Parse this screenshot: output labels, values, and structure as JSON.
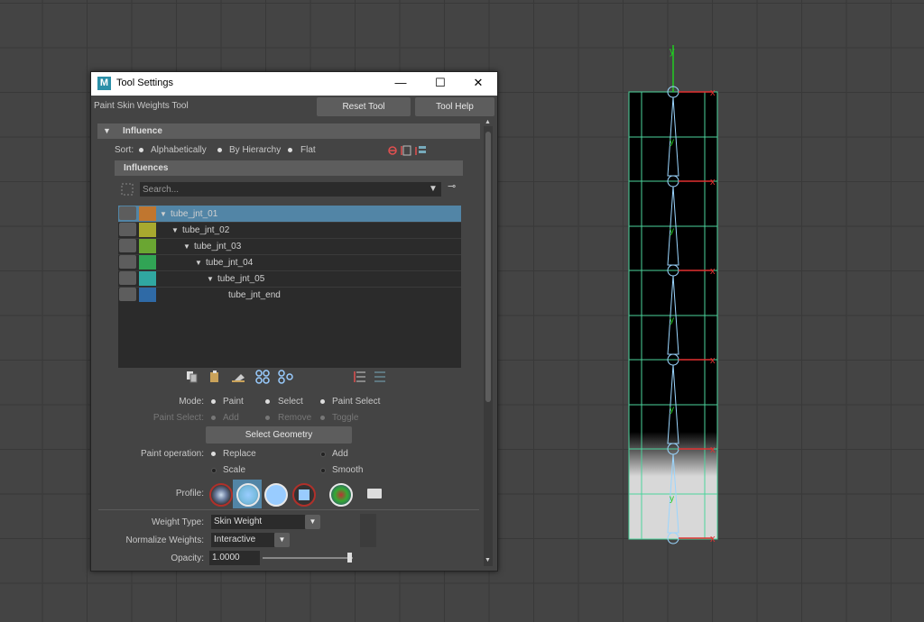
{
  "window": {
    "title": "Tool Settings",
    "logo": "M",
    "minimize_icon": "—",
    "maximize_icon": "☐",
    "close_icon": "✕"
  },
  "tool": {
    "name": "Paint Skin Weights Tool",
    "reset_label": "Reset Tool",
    "help_label": "Tool Help"
  },
  "influence": {
    "header": "Influence",
    "sort_label": "Sort:",
    "sort_options": [
      "Alphabetically",
      "By Hierarchy",
      "Flat"
    ],
    "sort_selected": "By Hierarchy",
    "subheader": "Influences",
    "search_placeholder": "Search...",
    "joints": [
      {
        "name": "tube_jnt_01",
        "color": "#c0762f",
        "depth": 0,
        "selected": true,
        "expanded": true
      },
      {
        "name": "tube_jnt_02",
        "color": "#a8a92f",
        "depth": 1,
        "selected": false,
        "expanded": true
      },
      {
        "name": "tube_jnt_03",
        "color": "#6aa632",
        "depth": 2,
        "selected": false,
        "expanded": true
      },
      {
        "name": "tube_jnt_04",
        "color": "#31a455",
        "depth": 3,
        "selected": false,
        "expanded": true
      },
      {
        "name": "tube_jnt_05",
        "color": "#30a7a1",
        "depth": 4,
        "selected": false,
        "expanded": true
      },
      {
        "name": "tube_jnt_end",
        "color": "#2f6aa6",
        "depth": 5,
        "selected": false,
        "expanded": false
      }
    ]
  },
  "mode": {
    "label": "Mode:",
    "options": [
      "Paint",
      "Select",
      "Paint Select"
    ],
    "selected": "Paint"
  },
  "paint_select": {
    "label": "Paint Select:",
    "options": [
      "Add",
      "Remove",
      "Toggle"
    ]
  },
  "select_geometry_label": "Select Geometry",
  "paint_operation": {
    "label": "Paint operation:",
    "options": [
      "Replace",
      "Add",
      "Scale",
      "Smooth"
    ],
    "selected": "Replace"
  },
  "profile": {
    "label": "Profile:",
    "selected_index": 1
  },
  "weight_type": {
    "label": "Weight Type:",
    "value": "Skin Weight"
  },
  "normalize": {
    "label": "Normalize Weights:",
    "value": "Interactive"
  },
  "opacity": {
    "label": "Opacity:",
    "value": "1.0000",
    "fraction": 1.0
  },
  "viewport": {
    "axis_y": "y",
    "axis_x": "x",
    "colors": {
      "joint": "#9bd6ff",
      "grid": "#4bd39b",
      "xaxis": "#e23030",
      "yaxis": "#22cc22"
    }
  }
}
